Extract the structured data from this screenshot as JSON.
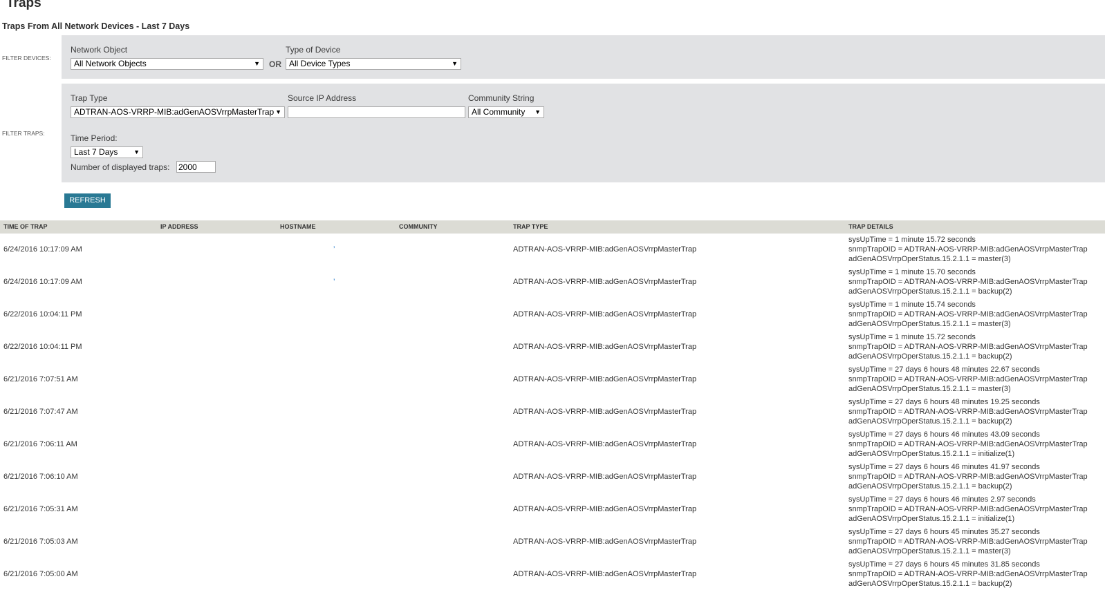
{
  "page": {
    "title": "Traps",
    "subtitle": "Traps From All Network Devices - Last 7 Days"
  },
  "filter_devices": {
    "section_label": "FILTER DEVICES:",
    "network_object_label": "Network Object",
    "network_object_value": "All Network Objects",
    "or_label": "OR",
    "device_type_label": "Type of Device",
    "device_type_value": "All Device Types"
  },
  "filter_traps": {
    "section_label": "FILTER TRAPS:",
    "trap_type_label": "Trap Type",
    "trap_type_value": "ADTRAN-AOS-VRRP-MIB:adGenAOSVrrpMasterTrap",
    "source_ip_label": "Source IP Address",
    "source_ip_value": "",
    "community_label": "Community String",
    "community_value": "All Community",
    "time_period_label": "Time Period:",
    "time_period_value": "Last 7 Days",
    "count_label": "Number of displayed traps:",
    "count_value": "2000"
  },
  "refresh_label": "REFRESH",
  "table": {
    "columns": [
      "TIME OF TRAP",
      "IP ADDRESS",
      "HOSTNAME",
      "COMMUNITY",
      "TRAP TYPE",
      "TRAP DETAILS"
    ],
    "rows": [
      {
        "time": "6/24/2016 10:17:09 AM",
        "ip": "",
        "hostname": "’",
        "community": "",
        "type": "ADTRAN-AOS-VRRP-MIB:adGenAOSVrrpMasterTrap",
        "details": [
          "sysUpTime = 1 minute 15.72 seconds",
          "snmpTrapOID = ADTRAN-AOS-VRRP-MIB:adGenAOSVrrpMasterTrap",
          "adGenAOSVrrpOperStatus.15.2.1.1 = master(3)"
        ]
      },
      {
        "time": "6/24/2016 10:17:09 AM",
        "ip": "",
        "hostname": "’",
        "community": "",
        "type": "ADTRAN-AOS-VRRP-MIB:adGenAOSVrrpMasterTrap",
        "details": [
          "sysUpTime = 1 minute 15.70 seconds",
          "snmpTrapOID = ADTRAN-AOS-VRRP-MIB:adGenAOSVrrpMasterTrap",
          "adGenAOSVrrpOperStatus.15.2.1.1 = backup(2)"
        ]
      },
      {
        "time": "6/22/2016 10:04:11 PM",
        "ip": "",
        "hostname": "",
        "community": "",
        "type": "ADTRAN-AOS-VRRP-MIB:adGenAOSVrrpMasterTrap",
        "details": [
          "sysUpTime = 1 minute 15.74 seconds",
          "snmpTrapOID = ADTRAN-AOS-VRRP-MIB:adGenAOSVrrpMasterTrap",
          "adGenAOSVrrpOperStatus.15.2.1.1 = master(3)"
        ]
      },
      {
        "time": "6/22/2016 10:04:11 PM",
        "ip": "",
        "hostname": "",
        "community": "",
        "type": "ADTRAN-AOS-VRRP-MIB:adGenAOSVrrpMasterTrap",
        "details": [
          "sysUpTime = 1 minute 15.72 seconds",
          "snmpTrapOID = ADTRAN-AOS-VRRP-MIB:adGenAOSVrrpMasterTrap",
          "adGenAOSVrrpOperStatus.15.2.1.1 = backup(2)"
        ]
      },
      {
        "time": "6/21/2016 7:07:51 AM",
        "ip": "",
        "hostname": "",
        "community": "",
        "type": "ADTRAN-AOS-VRRP-MIB:adGenAOSVrrpMasterTrap",
        "details": [
          "sysUpTime = 27 days 6 hours 48 minutes 22.67 seconds",
          "snmpTrapOID = ADTRAN-AOS-VRRP-MIB:adGenAOSVrrpMasterTrap",
          "adGenAOSVrrpOperStatus.15.2.1.1 = master(3)"
        ]
      },
      {
        "time": "6/21/2016 7:07:47 AM",
        "ip": "",
        "hostname": "",
        "community": "",
        "type": "ADTRAN-AOS-VRRP-MIB:adGenAOSVrrpMasterTrap",
        "details": [
          "sysUpTime = 27 days 6 hours 48 minutes 19.25 seconds",
          "snmpTrapOID = ADTRAN-AOS-VRRP-MIB:adGenAOSVrrpMasterTrap",
          "adGenAOSVrrpOperStatus.15.2.1.1 = backup(2)"
        ]
      },
      {
        "time": "6/21/2016 7:06:11 AM",
        "ip": "",
        "hostname": "",
        "community": "",
        "type": "ADTRAN-AOS-VRRP-MIB:adGenAOSVrrpMasterTrap",
        "details": [
          "sysUpTime = 27 days 6 hours 46 minutes 43.09 seconds",
          "snmpTrapOID = ADTRAN-AOS-VRRP-MIB:adGenAOSVrrpMasterTrap",
          "adGenAOSVrrpOperStatus.15.2.1.1 = initialize(1)"
        ]
      },
      {
        "time": "6/21/2016 7:06:10 AM",
        "ip": "",
        "hostname": "",
        "community": "",
        "type": "ADTRAN-AOS-VRRP-MIB:adGenAOSVrrpMasterTrap",
        "details": [
          "sysUpTime = 27 days 6 hours 46 minutes 41.97 seconds",
          "snmpTrapOID = ADTRAN-AOS-VRRP-MIB:adGenAOSVrrpMasterTrap",
          "adGenAOSVrrpOperStatus.15.2.1.1 = backup(2)"
        ]
      },
      {
        "time": "6/21/2016 7:05:31 AM",
        "ip": "",
        "hostname": "",
        "community": "",
        "type": "ADTRAN-AOS-VRRP-MIB:adGenAOSVrrpMasterTrap",
        "details": [
          "sysUpTime = 27 days 6 hours 46 minutes 2.97 seconds",
          "snmpTrapOID = ADTRAN-AOS-VRRP-MIB:adGenAOSVrrpMasterTrap",
          "adGenAOSVrrpOperStatus.15.2.1.1 = initialize(1)"
        ]
      },
      {
        "time": "6/21/2016 7:05:03 AM",
        "ip": "",
        "hostname": "",
        "community": "",
        "type": "ADTRAN-AOS-VRRP-MIB:adGenAOSVrrpMasterTrap",
        "details": [
          "sysUpTime = 27 days 6 hours 45 minutes 35.27 seconds",
          "snmpTrapOID = ADTRAN-AOS-VRRP-MIB:adGenAOSVrrpMasterTrap",
          "adGenAOSVrrpOperStatus.15.2.1.1 = master(3)"
        ]
      },
      {
        "time": "6/21/2016 7:05:00 AM",
        "ip": "",
        "hostname": "",
        "community": "",
        "type": "ADTRAN-AOS-VRRP-MIB:adGenAOSVrrpMasterTrap",
        "details": [
          "sysUpTime = 27 days 6 hours 45 minutes 31.85 seconds",
          "snmpTrapOID = ADTRAN-AOS-VRRP-MIB:adGenAOSVrrpMasterTrap",
          "adGenAOSVrrpOperStatus.15.2.1.1 = backup(2)"
        ]
      }
    ]
  }
}
